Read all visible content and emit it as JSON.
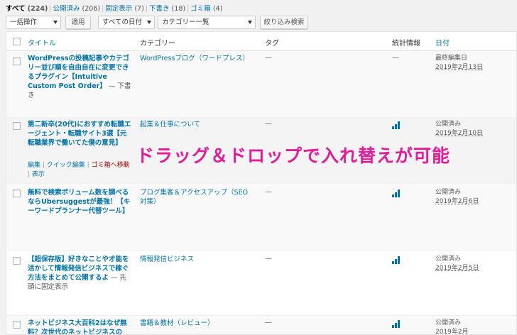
{
  "views": {
    "all": "すべて",
    "all_count": "(224)",
    "published": "公開済み",
    "published_count": "(206)",
    "sticky": "固定表示",
    "sticky_count": "(7)",
    "draft": "下書き",
    "draft_count": "(18)",
    "trash": "ゴミ箱",
    "trash_count": "(4)"
  },
  "toolbar": {
    "bulk_action": "一括操作",
    "apply": "適用",
    "all_dates": "すべての日付",
    "category_list": "カテゴリー一覧",
    "filter": "絞り込み検索"
  },
  "columns": {
    "title": "タイトル",
    "categories": "カテゴリー",
    "tags": "タグ",
    "stats": "統計情報",
    "date": "日付"
  },
  "rows": [
    {
      "title": "WordPressの投稿記事やカテゴリー並び順を自由自在に変更できるプラグイン【Intuitive Custom Post Order】",
      "state": " — 下書き",
      "category": "WordPressブログ（ワードプレス）",
      "tags": "—",
      "stats": "—",
      "date_status": "最終編集日",
      "date": "2019年2月13日"
    },
    {
      "title": "第二新卒(20代)におすすめ転職エージェント・転職サイト3選【元転職業界で働いてた僕の意見】",
      "state": "",
      "category": "起業＆仕事について",
      "tags": "—",
      "stats": "bar-chart-icon",
      "date_status": "公開済み",
      "date": "2019年2月10日",
      "actions": {
        "edit": "編集",
        "quick_edit": "クイック編集",
        "trash": "ゴミ箱へ移動",
        "view": "表示"
      }
    },
    {
      "title": "無料で検索ボリューム数を調べるならUbersuggestが最強！【キーワードプランナー代替ツール】",
      "state": "",
      "category": "ブログ集客＆アクセスアップ（SEO対策）",
      "tags": "—",
      "stats": "bar-chart-icon",
      "date_status": "公開済み",
      "date": "2019年2月6日"
    },
    {
      "title": "【超保存版】好きなことや才能を活かして情報発信ビジネスで稼ぐ方法をまとめて公開するよ",
      "state": " — 先頭に固定表示",
      "category": "情報発信ビジネス",
      "tags": "—",
      "stats": "bar-chart-icon",
      "date_status": "公開済み",
      "date": "2019年2月5日"
    },
    {
      "title": "ネットビジネス大百科2はなぜ無料？次世代のネットビジネスの",
      "state": "",
      "category": "書籍＆教材（レビュー）",
      "tags": "—",
      "stats": "bar-chart-icon",
      "date_status": "公開済み",
      "date": "2019年2月"
    }
  ],
  "overlay_text": "ドラッグ＆ドロップで入れ替えが可能",
  "colors": {
    "link": "#0073aa",
    "overlay": "#e6199b",
    "trash": "#a00"
  }
}
